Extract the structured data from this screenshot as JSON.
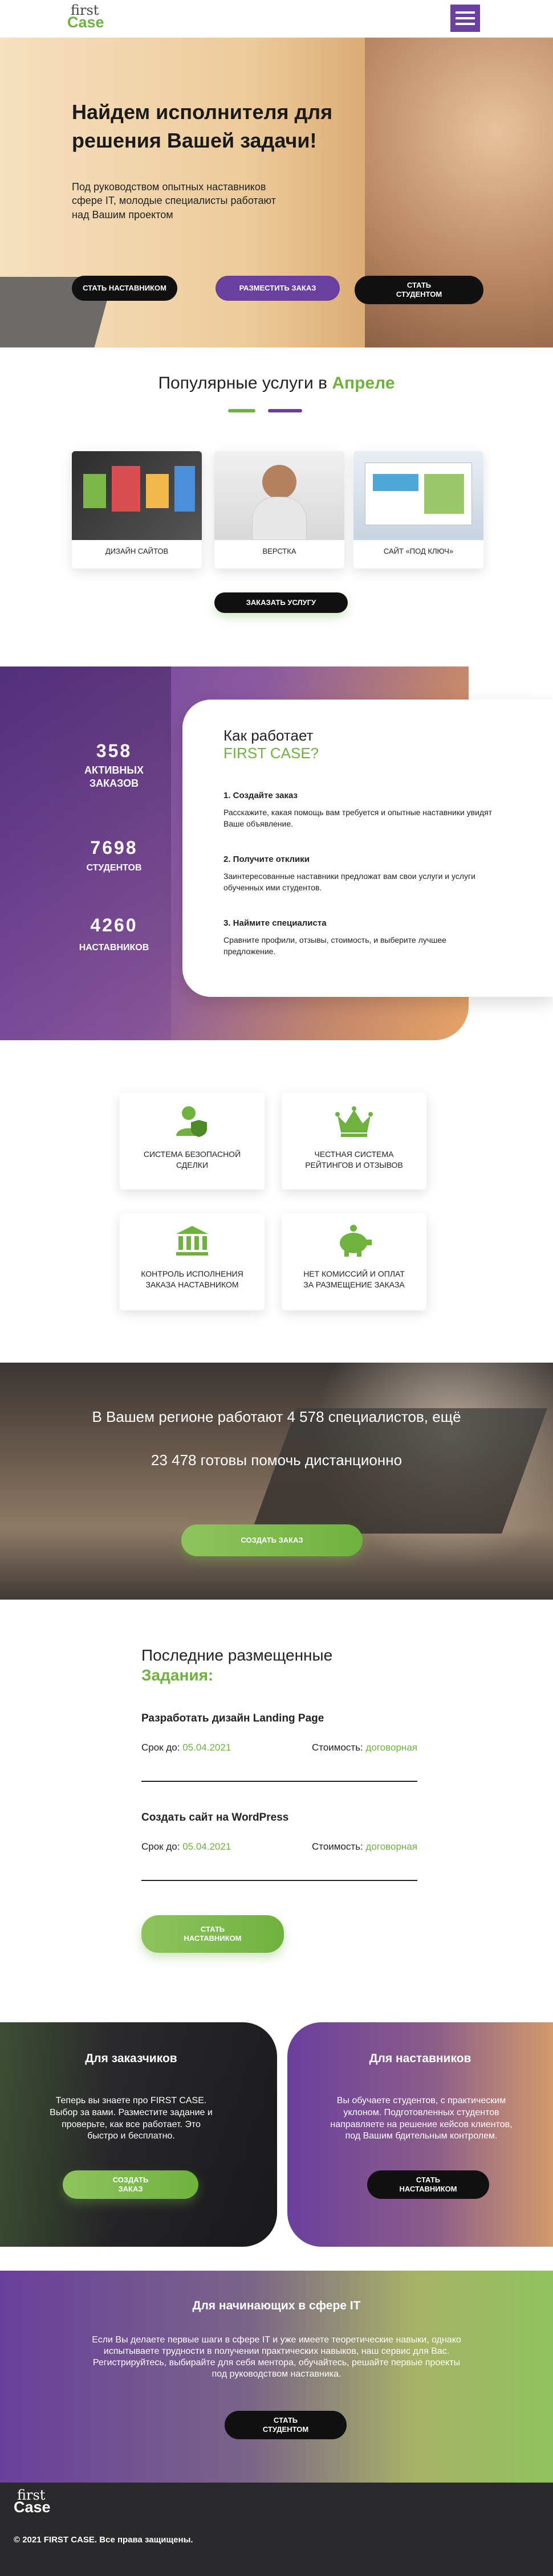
{
  "header": {
    "logo_top": "first",
    "logo_bottom": "Case"
  },
  "hero": {
    "title": "Найдем исполнителя для решения Вашей задачи!",
    "subtitle": "Под руководством опытных наставников сфере IT, молодые специалисты работают над Вашим проектом",
    "btn_mentor": "СТАТЬ НАСТАВНИКОМ",
    "btn_order": "РАЗМЕСТИТЬ ЗАКАЗ",
    "btn_student": "СТАТЬ СТУДЕНТОМ"
  },
  "services": {
    "title_a": "Популярные услуги в ",
    "title_b": "Апреле",
    "items": [
      "ДИЗАЙН САЙТОВ",
      "ВЕРСТКА",
      "САЙТ «ПОД КЛЮЧ»"
    ],
    "btn": "ЗАКАЗАТЬ УСЛУГУ"
  },
  "stats": {
    "items": [
      {
        "num": "358",
        "label": "АКТИВНЫХ ЗАКАЗОВ"
      },
      {
        "num": "7698",
        "label": "СТУДЕНТОВ"
      },
      {
        "num": "4260",
        "label": "НАСТАВНИКОВ"
      }
    ]
  },
  "how": {
    "title_a": "Как работает",
    "title_b": "FIRST CASE?",
    "steps": [
      {
        "h": "1. Создайте заказ",
        "p": "Расскажите, какая помощь вам требуется и опытные наставники увидят Ваше объявление."
      },
      {
        "h": "2. Получите отклики",
        "p": "Заинтересованные наставники предложат вам свои услуги и услуги обученных ими студентов."
      },
      {
        "h": "3. Наймите специалиста",
        "p": "Сравните профили, отзывы, стоимость, и выберите лучшее предложение."
      }
    ]
  },
  "features": [
    "СИСТЕМА БЕЗОПАСНОЙ СДЕЛКИ",
    "ЧЕСТНАЯ СИСТЕМА РЕЙТИНГОВ И ОТЗЫВОВ",
    "КОНТРОЛЬ ИСПОЛНЕНИЯ ЗАКАЗА НАСТАВНИКОМ",
    "НЕТ КОМИССИЙ И ОПЛАТ ЗА РАЗМЕЩЕНИЕ ЗАКАЗА"
  ],
  "region": {
    "line1": "В Вашем регионе работают 4 578 специалистов, ещё",
    "line2": "23 478 готовы помочь дистанционно",
    "btn": "СОЗДАТЬ ЗАКАЗ"
  },
  "tasks": {
    "title_a": "Последние размещенные",
    "title_b": "Задания:",
    "deadline_label": "Срок до:",
    "cost_label": "Стоимость:",
    "items": [
      {
        "title": "Разработать дизайн Landing Page",
        "date": "05.04.2021",
        "cost": "договорная"
      },
      {
        "title": "Создать сайт на WordPress",
        "date": "05.04.2021",
        "cost": "договорная"
      }
    ],
    "btn": "СТАТЬ НАСТАВНИКОМ"
  },
  "customers": {
    "title": "Для заказчиков",
    "text": "Теперь вы знаете про FIRST CASE. Выбор за вами. Разместите задание и проверьте, как все работает. Это быстро и бесплатно.",
    "btn": "СОЗДАТЬ ЗАКАЗ"
  },
  "mentors": {
    "title": "Для наставников",
    "text": "Вы обучаете студентов, с практическим уклоном. Подготовленных студентов направляете на решение кейсов клиентов, под Вашим бдительным контролем.",
    "btn": "СТАТЬ НАСТАВНИКОМ"
  },
  "beginners": {
    "title": "Для начинающих в сфере IT",
    "text": "Если Вы делаете первые шаги в сфере IT и уже имеете теоретические навыки, однако испытываете трудности в получении практических навыков, наш сервис для Вас. Регистрируйтесь, выбирайте для себя ментора, обучайтесь, решайте первые проекты под руководством наставника.",
    "btn": "СТАТЬ СТУДЕНТОМ"
  },
  "footer": {
    "logo_top": "first",
    "logo_bottom": "Case",
    "copy": "© 2021 FIRST CASE. Все права защищены."
  }
}
